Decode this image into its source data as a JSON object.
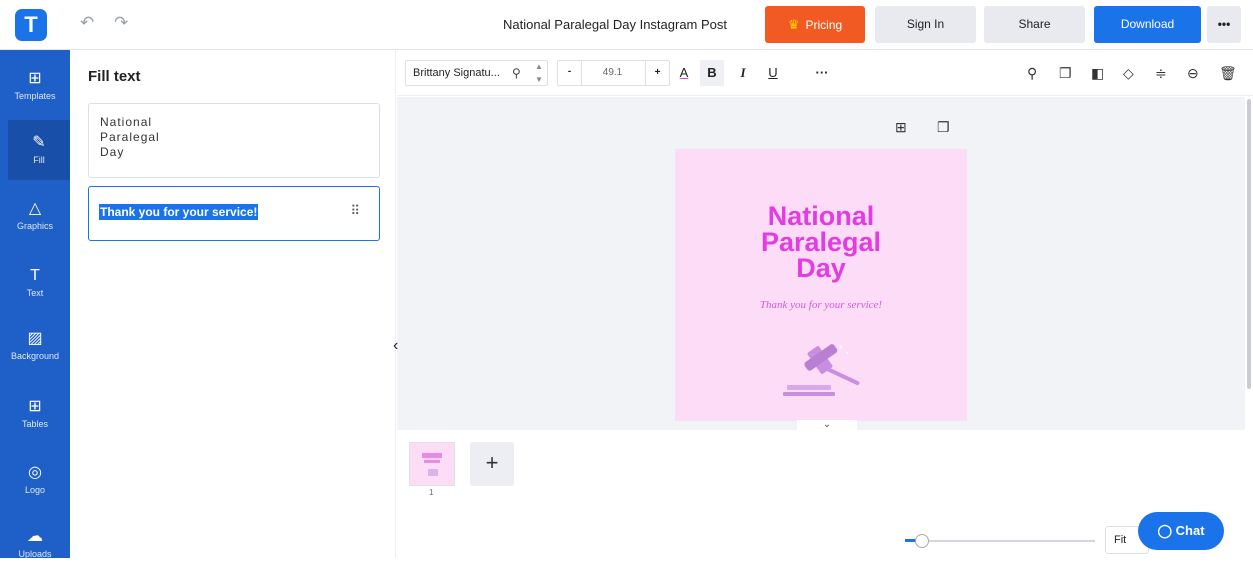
{
  "header": {
    "logo_letter": "T",
    "undo_icon": "↶",
    "redo_icon": "↷",
    "title": "National Paralegal Day Instagram Post",
    "pricing_label": "Pricing",
    "signin_label": "Sign In",
    "share_label": "Share",
    "download_label": "Download",
    "more_label": "•••"
  },
  "sidebar": {
    "items": [
      {
        "label": "Templates",
        "icon": "⊞"
      },
      {
        "label": "Fill",
        "icon": "✎"
      },
      {
        "label": "Graphics",
        "icon": "△"
      },
      {
        "label": "Text",
        "icon": "T"
      },
      {
        "label": "Background",
        "icon": "▨"
      },
      {
        "label": "Tables",
        "icon": "⊞"
      },
      {
        "label": "Logo",
        "icon": "◎"
      },
      {
        "label": "Uploads",
        "icon": "☁"
      }
    ]
  },
  "panel": {
    "title": "Fill text",
    "text_box_1": [
      "National",
      "Paralegal",
      "Day"
    ],
    "text_box_2": "Thank you for your service!",
    "drag_handle": "⠿"
  },
  "toolbar": {
    "font_name": "Brittany Signatu...",
    "font_size": "49.1",
    "minus": "-",
    "plus": "+",
    "color_label": "A",
    "bold_label": "B",
    "italic_label": "I",
    "underline_label": "U",
    "more_label": "···"
  },
  "canvas": {
    "design_title_lines": [
      "National",
      "Paralegal",
      "Day"
    ],
    "design_script": "Thank you for your service!",
    "colors": {
      "bg": "#fddcf8",
      "heading": "#e33ce0"
    }
  },
  "pages": {
    "page_number": "1",
    "add_label": "+"
  },
  "bottom": {
    "fit_label": "Fit",
    "chat_label": "Chat",
    "zoom_level": 0.05
  }
}
